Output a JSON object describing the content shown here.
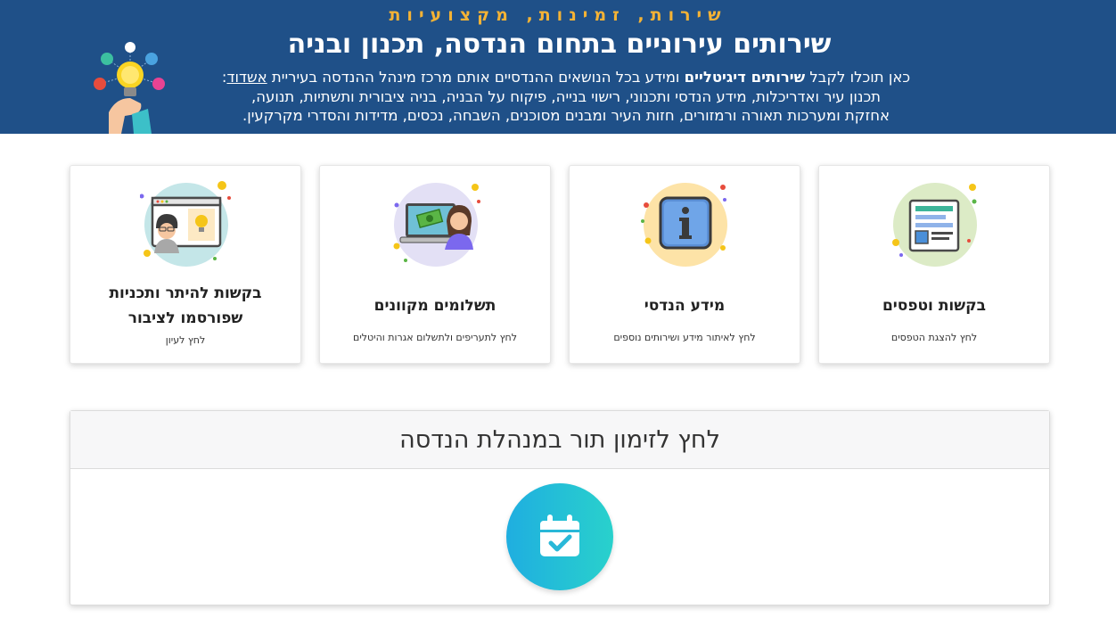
{
  "header": {
    "tagline": "שירות, זמינות, מקצועיות",
    "title": "שירותים עירוניים בתחום הנדסה, תכנון ובניה",
    "intro_prefix": "כאן תוכלו לקבל ",
    "intro_bold": "שירותים דיגיטליים",
    "intro_middle": " ומידע בכל הנושאים ההנדסיים אותם מרכז מינהל ההנדסה בעיריית ",
    "intro_city": "אשדוד",
    "intro_colon": ":",
    "intro_line2": "תכנון עיר ואדריכלות, מידע הנדסי ותכנוני, רישוי בנייה, פיקוח על הבניה, בניה ציבורית ותשתיות, תנועה,",
    "intro_line3": "אחזקת ומערכות תאורה ורמזורים, חזות העיר ומבנים מסוכנים, השבחה, נכסים, מדידות והסדרי מקרקעין."
  },
  "cards": [
    {
      "title": "בקשות וטפסים",
      "subtitle": "לחץ להצגת הטפסים",
      "icon": "forms-icon"
    },
    {
      "title": "מידע הנדסי",
      "subtitle": "לחץ לאיתור מידע ושירותים נוספים",
      "icon": "info-icon"
    },
    {
      "title": "תשלומים מקוונים",
      "subtitle": "לחץ לתעריפים ולתשלום אגרות והיטלים",
      "icon": "payment-icon"
    },
    {
      "title_line1": "בקשות להיתר ותכניות",
      "title_line2": "שפורסמו לציבור",
      "subtitle": "לחץ לעיון",
      "icon": "published-plans-icon"
    }
  ],
  "appointment": {
    "label": "לחץ לזימון תור במנהלת הנדסה",
    "icon": "calendar-check-icon"
  },
  "colors": {
    "header_bg": "#1f5088",
    "tagline": "#f5b335",
    "calendar_gradient_start": "#1faee0",
    "calendar_gradient_end": "#29d1cc"
  }
}
